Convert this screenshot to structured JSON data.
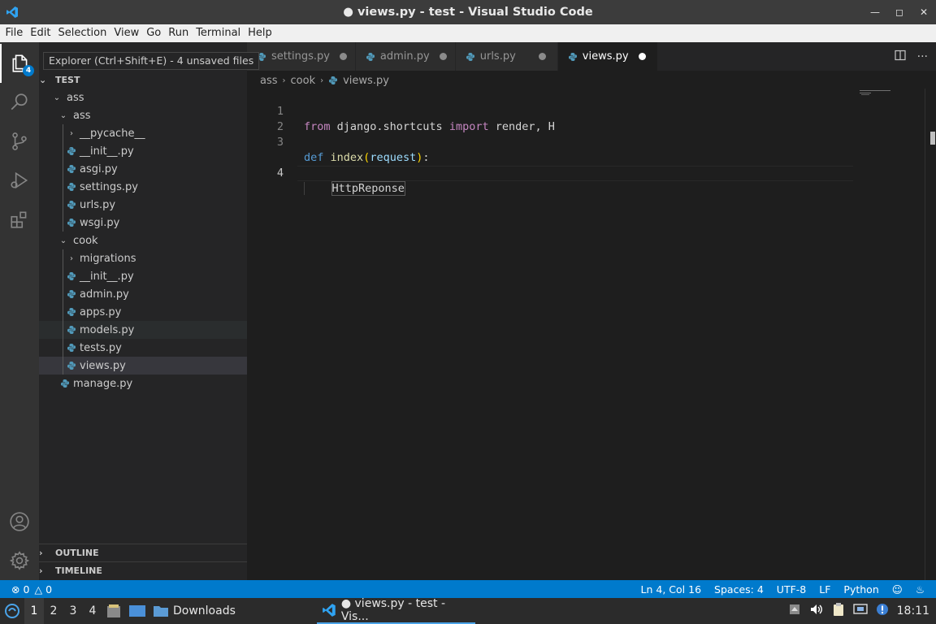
{
  "window": {
    "title": "● views.py - test - Visual Studio Code"
  },
  "menu": [
    "File",
    "Edit",
    "Selection",
    "View",
    "Go",
    "Run",
    "Terminal",
    "Help"
  ],
  "activity": {
    "explorer_badge": "4",
    "tooltip": "Explorer (Ctrl+Shift+E) - 4 unsaved files"
  },
  "explorer": {
    "root": "TEST",
    "items": [
      {
        "label": "ass",
        "kind": "folder-open",
        "depth": 1
      },
      {
        "label": "ass",
        "kind": "folder-open",
        "depth": 2
      },
      {
        "label": "__pycache__",
        "kind": "folder-closed",
        "depth": 3
      },
      {
        "label": "__init__.py",
        "kind": "py",
        "depth": 3
      },
      {
        "label": "asgi.py",
        "kind": "py",
        "depth": 3
      },
      {
        "label": "settings.py",
        "kind": "py",
        "depth": 3
      },
      {
        "label": "urls.py",
        "kind": "py",
        "depth": 3
      },
      {
        "label": "wsgi.py",
        "kind": "py",
        "depth": 3
      },
      {
        "label": "cook",
        "kind": "folder-open",
        "depth": 2
      },
      {
        "label": "migrations",
        "kind": "folder-closed",
        "depth": 3
      },
      {
        "label": "__init__.py",
        "kind": "py",
        "depth": 3
      },
      {
        "label": "admin.py",
        "kind": "py",
        "depth": 3
      },
      {
        "label": "apps.py",
        "kind": "py",
        "depth": 3
      },
      {
        "label": "models.py",
        "kind": "py",
        "depth": 3,
        "state": "hover"
      },
      {
        "label": "tests.py",
        "kind": "py",
        "depth": 3
      },
      {
        "label": "views.py",
        "kind": "py",
        "depth": 3,
        "state": "selected"
      },
      {
        "label": "manage.py",
        "kind": "py",
        "depth": 2
      }
    ],
    "outline": "OUTLINE",
    "timeline": "TIMELINE"
  },
  "tabs": [
    {
      "label": "settings.py",
      "active": false
    },
    {
      "label": "admin.py",
      "active": false
    },
    {
      "label": "urls.py",
      "active": false
    },
    {
      "label": "views.py",
      "active": true
    }
  ],
  "breadcrumb": [
    "ass",
    "cook",
    "views.py"
  ],
  "code": {
    "line_numbers": [
      "1",
      "2",
      "3",
      "4"
    ],
    "l1": {
      "from": "from",
      "module": " django.shortcuts ",
      "import": "import",
      "rest": " render, H"
    },
    "l3": {
      "def": "def",
      "name": "index",
      "open": "(",
      "param": "request",
      "close": ")",
      "colon": ":"
    },
    "l4": {
      "indent": "    ",
      "word": "HttpReponse"
    }
  },
  "status": {
    "errors": "0",
    "warnings": "0",
    "position": "Ln 4, Col 16",
    "spaces": "Spaces: 4",
    "encoding": "UTF-8",
    "eol": "LF",
    "language": "Python"
  },
  "taskbar": {
    "workspaces": [
      "1",
      "2",
      "3",
      "4"
    ],
    "downloads": "Downloads",
    "active_window": "● views.py - test - Vis...",
    "clock": "18:11"
  },
  "colors": {
    "accent": "#007acc",
    "python_icon": "#519aba"
  }
}
